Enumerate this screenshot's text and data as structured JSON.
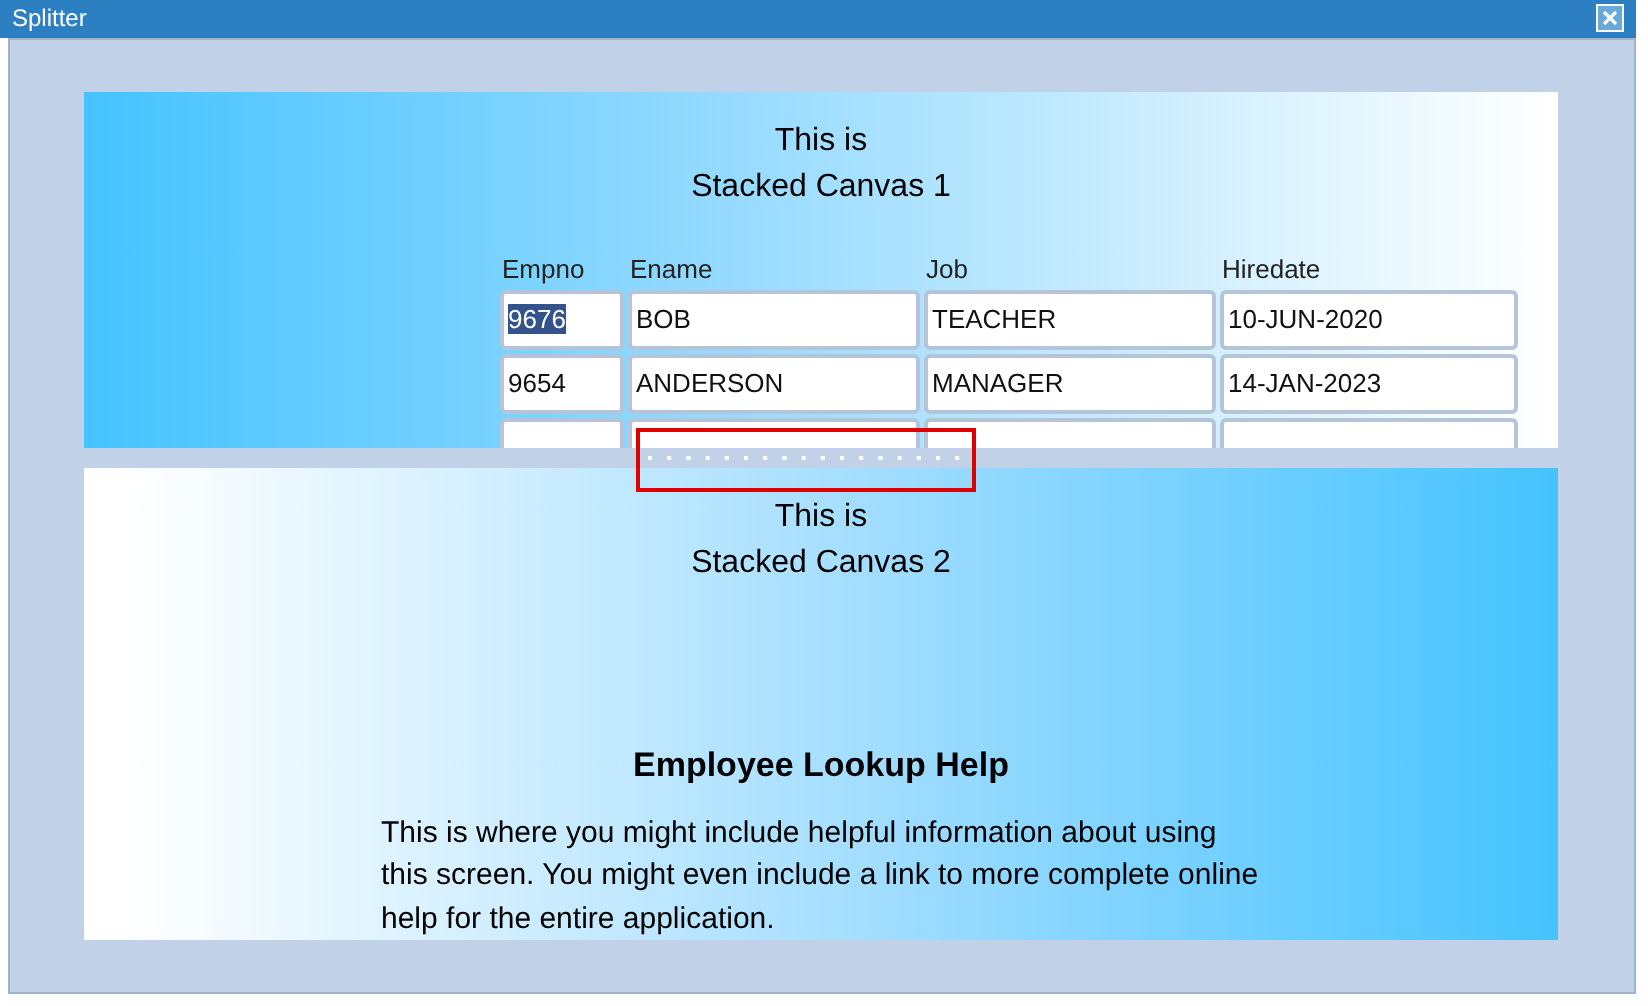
{
  "window": {
    "title": "Splitter"
  },
  "top_canvas": {
    "lines": [
      "This is",
      "Stacked Canvas 1"
    ],
    "table": {
      "columns": [
        "Empno",
        "Ename",
        "Job",
        "Hiredate"
      ],
      "rows": [
        {
          "cells": [
            "9676",
            "BOB",
            "TEACHER",
            "10-JUN-2020"
          ],
          "text_selected": true
        },
        {
          "cells": [
            "9654",
            "ANDERSON",
            "MANAGER",
            "14-JAN-2023"
          ],
          "text_selected": false
        }
      ]
    }
  },
  "splitter": {
    "highlighted": true
  },
  "bottom_canvas": {
    "lines": [
      "This is",
      "Stacked Canvas 2"
    ],
    "heading": "Employee Lookup Help",
    "paragraph": "This is where you might include helpful information about using this screen.  You might even include a link to more complete online help for the entire application."
  }
}
